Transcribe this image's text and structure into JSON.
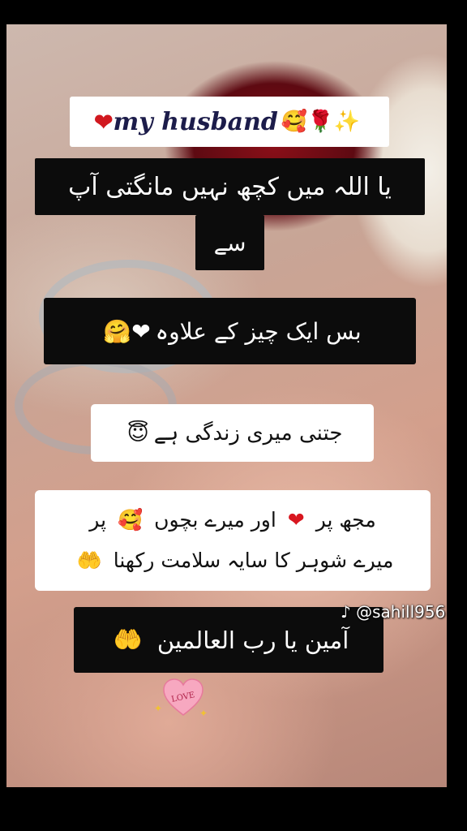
{
  "title": {
    "text": "my husband",
    "heart": "❤",
    "emojis": "🥰🌹✨"
  },
  "lines": {
    "line1": "یا اللہ میں کچھ نہیں مانگتی آپ",
    "line1b": "سے",
    "line2_text": "بس ایک چیز کے علاوہ",
    "line2_emojis": "🤗❤",
    "line3_text": "جتنی میری زندگی ہے",
    "line3_emoji": "😇",
    "line4a_part1": "مجھ پر",
    "line4a_heart": "❤",
    "line4a_part2": "اور میرے بچوں",
    "line4a_emoji": "🥰",
    "line4a_part3": "پر",
    "line4b_text": "میرے شوہر کا سایہ سلامت رکھنا",
    "line4b_emoji": "🤲",
    "line5_text": "آمین یا رب العالمین",
    "line5_emoji": "🤲"
  },
  "watermark": {
    "icon": "♪",
    "handle": "@sahill956"
  },
  "sticker": {
    "text": "LOVE"
  },
  "colors": {
    "background": "#000000",
    "heart_red": "#d8161f",
    "dark_box": "#0c0c0c",
    "light_box": "#ffffff"
  }
}
